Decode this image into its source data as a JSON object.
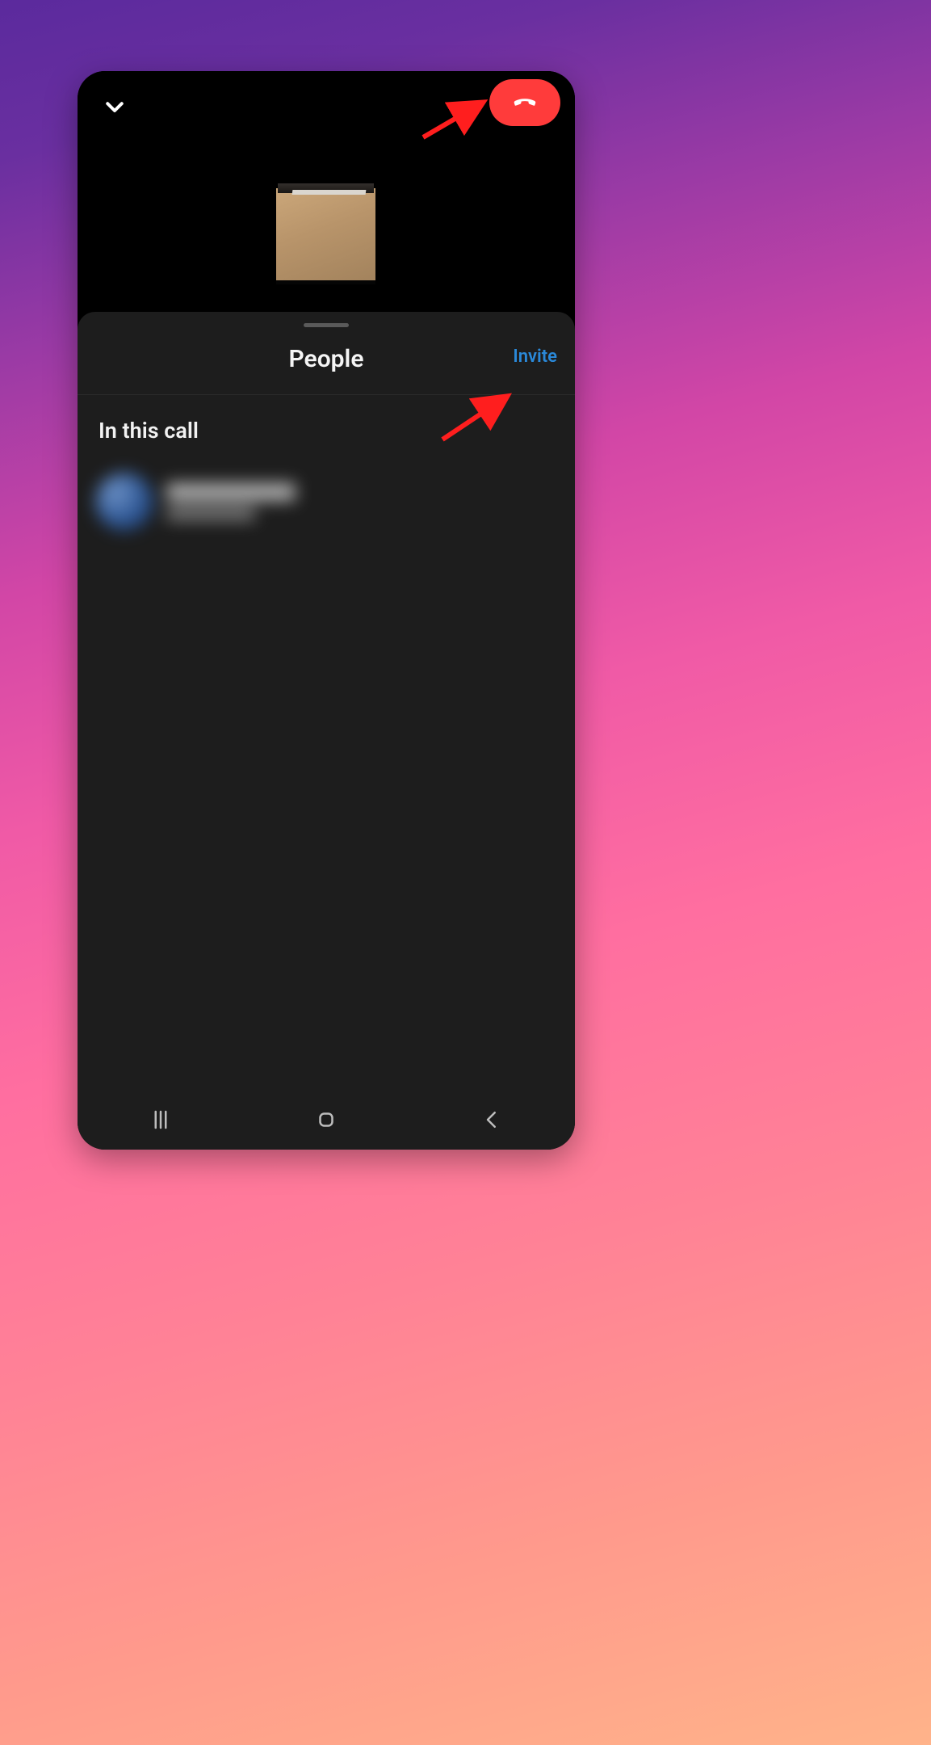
{
  "sheet": {
    "title": "People",
    "invite_label": "Invite",
    "section_label": "In this call"
  },
  "colors": {
    "hangup": "#ff3b3b",
    "link": "#2a88d8",
    "panel": "#1d1d1d"
  },
  "annotations": [
    {
      "target": "hangup-button"
    },
    {
      "target": "invite-link"
    }
  ],
  "icons": {
    "collapse": "chevron-down",
    "hangup": "phone-hangup",
    "nav": [
      "recents",
      "home",
      "back"
    ]
  }
}
